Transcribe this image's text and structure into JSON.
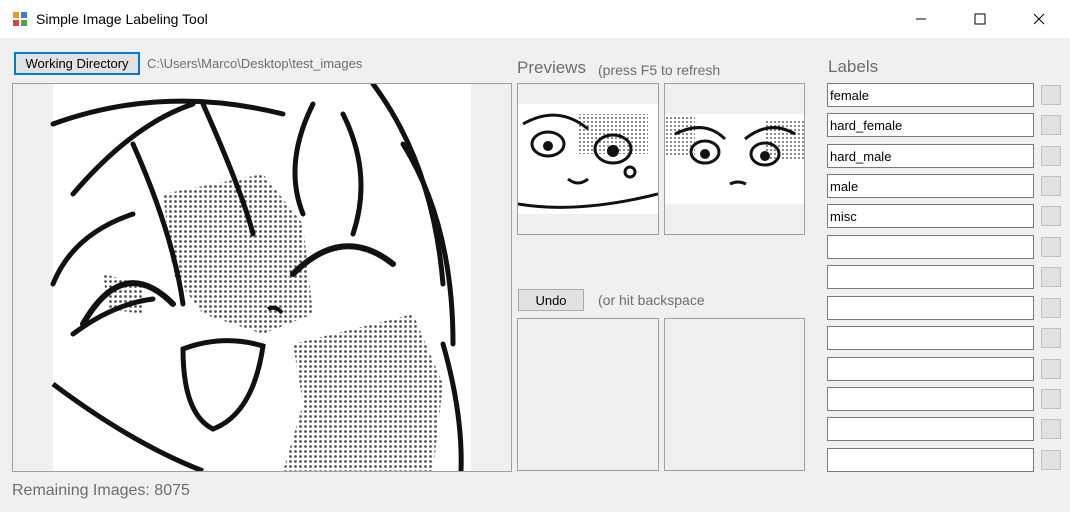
{
  "window": {
    "title": "Simple Image Labeling Tool",
    "controls": {
      "minimize": "minimize-icon",
      "maximize": "maximize-icon",
      "close": "close-icon"
    }
  },
  "toolbar": {
    "working_directory_button": "Working Directory",
    "path": "C:\\Users\\Marco\\Desktop\\test_images"
  },
  "previews": {
    "heading": "Previews",
    "hint": "(press F5 to refresh"
  },
  "undo": {
    "button": "Undo",
    "hint": "(or hit backspace"
  },
  "labels": {
    "heading": "Labels",
    "items": [
      "female",
      "hard_female",
      "hard_male",
      "male",
      "misc",
      "",
      "",
      "",
      "",
      "",
      "",
      "",
      ""
    ]
  },
  "status": {
    "remaining": "Remaining Images: 8075"
  }
}
